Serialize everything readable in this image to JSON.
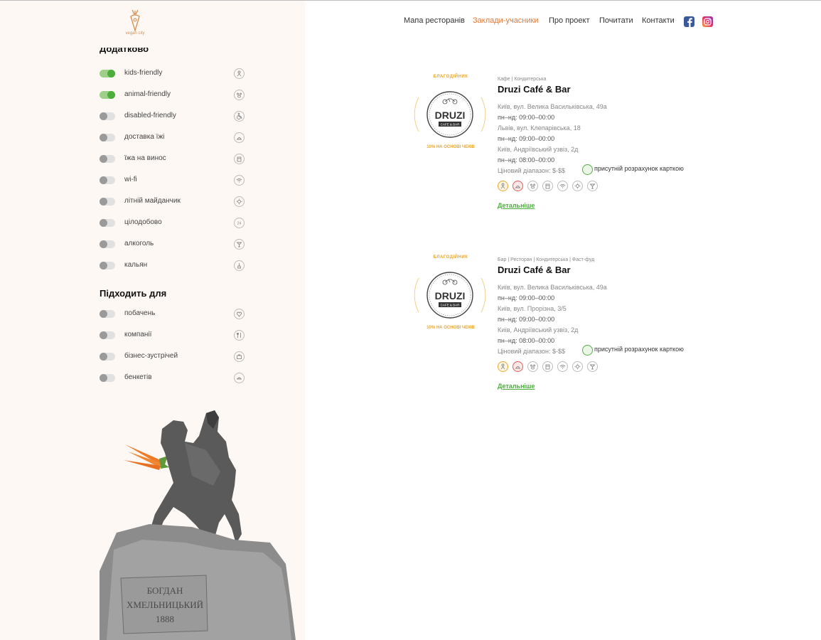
{
  "brand": {
    "logo_text": "vegan city"
  },
  "nav": [
    "Мапа ресторанів",
    "Заклади-учасники",
    "Про проект",
    "Почитати",
    "Контакти"
  ],
  "social": [
    "facebook-icon",
    "instagram-icon"
  ],
  "sidebar": {
    "section_extra": "Додатково",
    "extra_options": [
      {
        "label": "kids-friendly",
        "on": true,
        "icon": "kids-icon"
      },
      {
        "label": "animal-friendly",
        "on": true,
        "icon": "paw-icon"
      },
      {
        "label": "disabled-friendly",
        "on": false,
        "icon": "wheelchair-icon"
      },
      {
        "label": "доставка їжі",
        "on": false,
        "icon": "delivery-icon"
      },
      {
        "label": "їжа на винос",
        "on": false,
        "icon": "takeaway-icon"
      },
      {
        "label": "wi-fi",
        "on": false,
        "icon": "wifi-icon"
      },
      {
        "label": "літній майданчик",
        "on": false,
        "icon": "sun-icon"
      },
      {
        "label": "цілодобово",
        "on": false,
        "icon": "24h-icon"
      },
      {
        "label": "алкоголь",
        "on": false,
        "icon": "cocktail-icon"
      },
      {
        "label": "кальян",
        "on": false,
        "icon": "hookah-icon"
      }
    ],
    "section_suitable": "Підходить для",
    "suitable_options": [
      {
        "label": "побачень",
        "on": false,
        "icon": "heart-icon"
      },
      {
        "label": "компанії",
        "on": false,
        "icon": "cutlery-icon"
      },
      {
        "label": "бізнес-зустрічей",
        "on": false,
        "icon": "briefcase-icon"
      },
      {
        "label": "бенкетів",
        "on": false,
        "icon": "banquet-icon"
      }
    ],
    "statue_inscription": [
      "БОГДАН",
      "ХМЕЛЬНИЦЬКИЙ",
      "1888"
    ]
  },
  "cards": [
    {
      "badge_top": "БЛАГОДІЙНИК",
      "badge_bottom": "10% НА ОСНОВІ ЧЕКІВ",
      "logo_name": "DRUZI",
      "logo_sub": "CAFE & BAR",
      "category": "Кафе | Кондитерська",
      "name": "Druzi Café & Bar",
      "lines": [
        "Київ, вул. Велика Васильківська, 49а",
        "пн–нд: 09:00–00:00",
        "Львів, вул. Клепарівська, 18",
        "пн–нд: 09:00–00:00",
        "Київ, Андріївський узвіз, 2д",
        "пн–нд: 08:00–00:00"
      ],
      "price": "Ціновий діапазон: $-$$",
      "payment": "присутній розрахунок карткою",
      "icons": [
        "kids-icon",
        "delivery-icon",
        "paw-icon",
        "takeaway-icon",
        "wifi-icon",
        "sun-icon",
        "cocktail-icon"
      ],
      "more": "Детальніше"
    },
    {
      "badge_top": "БЛАГОДІЙНИК",
      "badge_bottom": "10% НА ОСНОВІ ЧЕКІВ",
      "logo_name": "DRUZI",
      "logo_sub": "CAFE & BAR",
      "category": "Бар | Ресторан | Кондитерська | Фаст-фуд",
      "name": "Druzi Café & Bar",
      "lines": [
        "Київ, вул. Велика Васильківська, 49а",
        "пн–нд: 09:00–00:00",
        "Київ, вул. Прорізна, 3/5",
        "пн–нд: 09:00–00:00",
        "Київ, Андріївський узвіз, 2д",
        "пн–нд: 08:00–00:00"
      ],
      "price": "Ціновий діапазон: $-$$",
      "payment": "присутній розрахунок карткою",
      "icons": [
        "kids-icon",
        "delivery-icon",
        "paw-icon",
        "takeaway-icon",
        "wifi-icon",
        "sun-icon",
        "cocktail-icon"
      ],
      "more": "Детальніше"
    }
  ]
}
